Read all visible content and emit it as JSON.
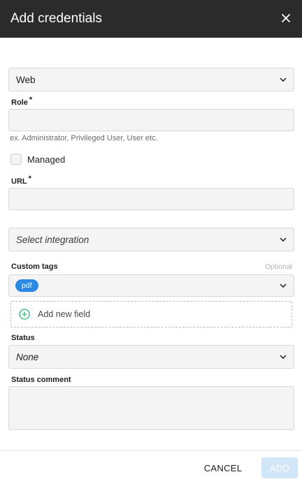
{
  "dialog": {
    "title": "Add credentials",
    "close_icon": "close-icon"
  },
  "type_select": {
    "value": "Web"
  },
  "role": {
    "label": "Role",
    "required_marker": "*",
    "value": "",
    "helper": "ex. Administrator, Privileged User, User etc."
  },
  "managed": {
    "label": "Managed",
    "checked": false
  },
  "url": {
    "label": "URL",
    "required_marker": "*",
    "value": ""
  },
  "integration": {
    "placeholder": "Select integration"
  },
  "custom_tags": {
    "label": "Custom tags",
    "optional": "Optional",
    "tags": [
      "pdf"
    ]
  },
  "add_field": {
    "label": "Add new field",
    "icon": "plus-circle-icon"
  },
  "status": {
    "label": "Status",
    "value": "None"
  },
  "status_comment": {
    "label": "Status comment",
    "value": ""
  },
  "footer": {
    "cancel": "CANCEL",
    "add": "ADD"
  },
  "colors": {
    "header_bg": "#2b2b2b",
    "chip_bg": "#2d8ae2",
    "add_button_bg": "#d2e6fa",
    "plus_icon": "#2bb673"
  }
}
